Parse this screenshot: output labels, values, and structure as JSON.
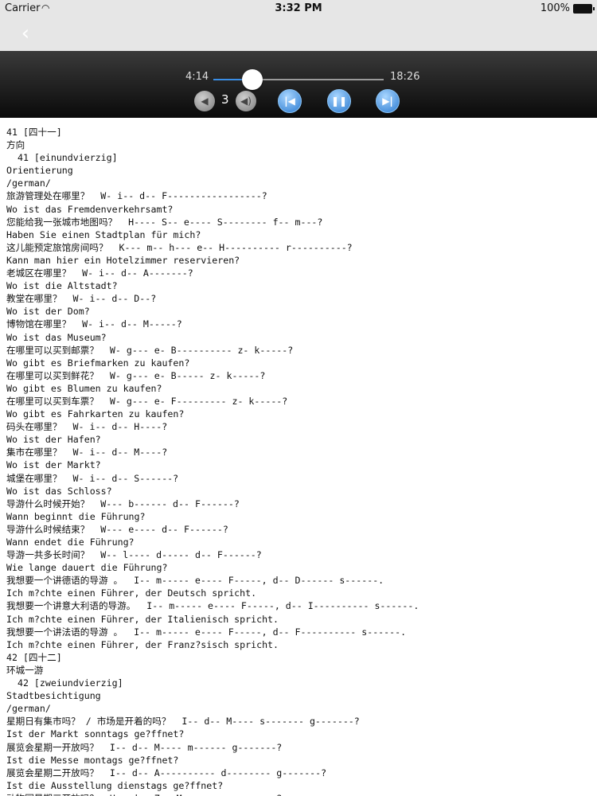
{
  "status_bar": {
    "carrier": "Carrier",
    "time": "3:32 PM",
    "battery": "100%"
  },
  "nav": {
    "back_icon": "chevron-left-icon",
    "back_glyph": "‹"
  },
  "player": {
    "current_time": "4:14",
    "total_time": "18:26",
    "progress": 0.23,
    "volume_level": "3",
    "icons": {
      "volume_down": "speaker-low-icon",
      "volume_up": "speaker-high-icon",
      "previous": "skip-back-icon",
      "pause": "pause-icon",
      "next": "skip-forward-icon"
    }
  },
  "lines": [
    "41 [四十一]",
    "方向",
    "  41 [einundvierzig]",
    "Orientierung",
    "/german/",
    "旅游管理处在哪里？  W- i-- d-- F-----------------?",
    "Wo ist das Fremdenverkehrsamt?",
    "您能给我一张城市地图吗？  H---- S-- e---- S-------- f-- m---?",
    "Haben Sie einen Stadtplan für mich?",
    "这儿能预定旅馆房间吗？  K--- m-- h--- e-- H---------- r----------?",
    "Kann man hier ein Hotelzimmer reservieren?",
    "老城区在哪里？  W- i-- d-- A-------?",
    "Wo ist die Altstadt?",
    "教堂在哪里？  W- i-- d-- D--?",
    "Wo ist der Dom?",
    "博物馆在哪里？  W- i-- d-- M-----?",
    "Wo ist das Museum?",
    "在哪里可以买到邮票？  W- g--- e- B---------- z- k-----?",
    "Wo gibt es Briefmarken zu kaufen?",
    "在哪里可以买到鲜花？  W- g--- e- B----- z- k-----?",
    "Wo gibt es Blumen zu kaufen?",
    "在哪里可以买到车票？  W- g--- e- F--------- z- k-----?",
    "Wo gibt es Fahrkarten zu kaufen?",
    "码头在哪里？  W- i-- d-- H----?",
    "Wo ist der Hafen?",
    "集市在哪里？  W- i-- d-- M----?",
    "Wo ist der Markt?",
    "城堡在哪里？  W- i-- d-- S------?",
    "Wo ist das Schloss?",
    "导游什么时候开始？  W--- b------ d-- F------?",
    "Wann beginnt die Führung?",
    "导游什么时候结束？  W--- e---- d-- F------?",
    "Wann endet die Führung?",
    "导游一共多长时间？  W-- l---- d----- d-- F------?",
    "Wie lange dauert die Führung?",
    "我想要一个讲德语的导游 。  I-- m----- e---- F-----, d-- D------ s------.",
    "Ich m?chte einen Führer, der Deutsch spricht.",
    "我想要一个讲意大利语的导游。  I-- m----- e---- F-----, d-- I---------- s------.",
    "Ich m?chte einen Führer, der Italienisch spricht.",
    "我想要一个讲法语的导游 。  I-- m----- e---- F-----, d-- F---------- s------.",
    "Ich m?chte einen Führer, der Franz?sisch spricht.",
    "42 [四十二]",
    "环城一游",
    "  42 [zweiundvierzig]",
    "Stadtbesichtigung",
    "/german/",
    "星期日有集市吗？ / 市场是开着的吗？  I-- d-- M---- s------- g-------?",
    "Ist der Markt sonntags ge?ffnet?",
    "展览会星期一开放吗？  I-- d-- M---- m------ g-------?",
    "Ist die Messe montags ge?ffnet?",
    "展览会星期二开放吗？  I-- d-- A---------- d-------- g-------?",
    "Ist die Ausstellung dienstags ge?ffnet?",
    "动物园星期三开放吗？  H-- d-- Z-- M-------- g-------?"
  ]
}
